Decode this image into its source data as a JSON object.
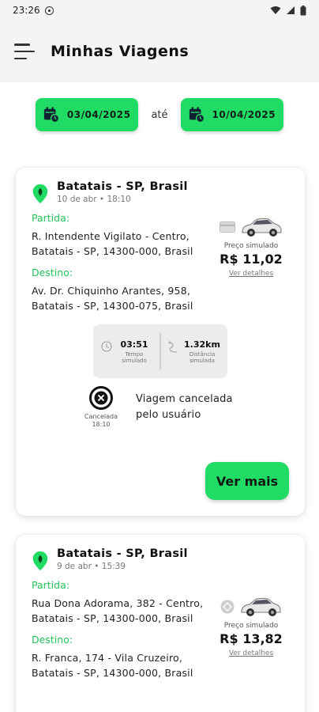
{
  "status_bar": {
    "time": "23:26"
  },
  "header": {
    "title": "Minhas Viagens"
  },
  "filter": {
    "start_date": "03/04/2025",
    "separator": "até",
    "end_date": "10/04/2025"
  },
  "trips": [
    {
      "city": "Batatais - SP, Brasil",
      "when": "10 de abr • 18:10",
      "departure_label": "Partida:",
      "departure": "R. Intendente Vigilato - Centro, Batatais - SP, 14300-000, Brasil",
      "destination_label": "Destino:",
      "destination": "Av. Dr. Chiquinho Arantes, 958, Batatais - SP, 14300-075, Brasil",
      "price_label": "Preço simulado",
      "price": "R$ 11,02",
      "details_link": "Ver detalhes",
      "time_value": "03:51",
      "time_label": "Tempo simulado",
      "distance_value": "1.32km",
      "distance_label": "Distância simulada",
      "cancel_label": "Cancelada 18:10",
      "cancel_message": "Viagem cancelada pelo usuário",
      "more_button": "Ver mais",
      "payment_icon": "card-icon"
    },
    {
      "city": "Batatais - SP, Brasil",
      "when": "9 de abr • 15:39",
      "departure_label": "Partida:",
      "departure": "Rua Dona Adorama, 382 - Centro, Batatais - SP, 14300-000, Brasil",
      "destination_label": "Destino:",
      "destination": "R. Franca, 174 - Vila Cruzeiro, Batatais - SP, 14300-000, Brasil",
      "price_label": "Preço simulado",
      "price": "R$ 13,82",
      "details_link": "Ver detalhes",
      "payment_icon": "pix-icon"
    }
  ],
  "colors": {
    "accent": "#21dc64",
    "label_green": "#21c45a",
    "header_bg": "#f4f4f4"
  }
}
